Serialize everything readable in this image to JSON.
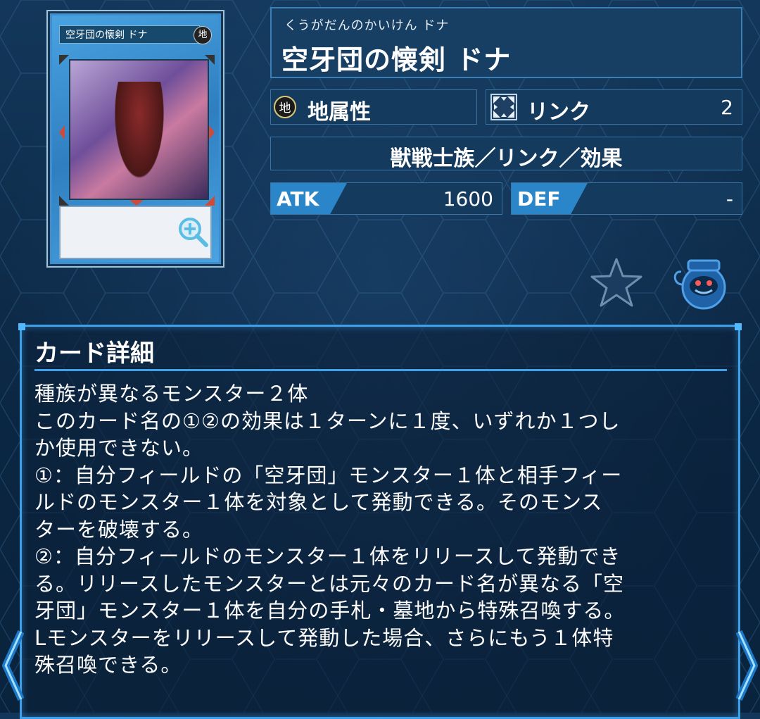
{
  "card": {
    "frame_name": "空牙団の懐剣 ドナ",
    "frame_attr": "地",
    "art_description_icon": "zoom-magnifier-icon"
  },
  "header": {
    "ruby": "くうがだんのかいけん ドナ",
    "title": "空牙団の懐剣 ドナ"
  },
  "attribute": {
    "icon_text": "地",
    "label": "地属性"
  },
  "type": {
    "icon": "link-arrows-icon",
    "label": "リンク",
    "value": "2"
  },
  "race": {
    "label": "獣戦士族／リンク／効果"
  },
  "stats": {
    "atk_label": "ATK",
    "atk_value": "1600",
    "def_label": "DEF",
    "def_value": "-"
  },
  "actions": {
    "favorite_icon": "star-icon",
    "pot_icon": "pot-of-greed-icon"
  },
  "details": {
    "title": "カード詳細",
    "text": "種族が異なるモンスター２体\nこのカード名の①②の効果は１ターンに１度、いずれか１つし\nか使用できない。\n①：自分フィールドの「空牙団」モンスター１体と相手フィー\nルドのモンスター１体を対象として発動できる。そのモンス\nターを破壊する。\n②：自分フィールドのモンスター１体をリリースして発動でき\nる。リリースしたモンスターとは元々のカード名が異なる「空\n牙団」モンスター１体を自分の手札・墓地から特殊召喚する。\nLモンスターをリリースして発動した場合、さらにもう１体特\n殊召喚できる。"
  },
  "colors": {
    "accent": "#3ea0e8",
    "panel": "#143a5e",
    "tag": "#2a86c8"
  }
}
